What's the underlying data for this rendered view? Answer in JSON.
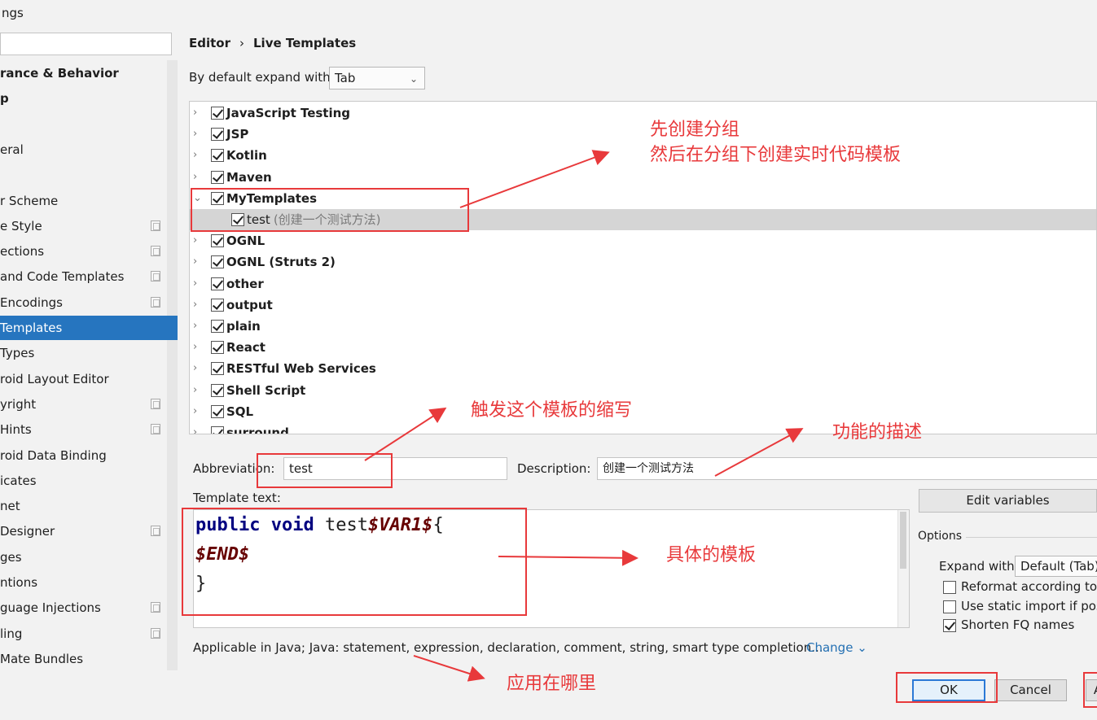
{
  "window": {
    "title": "ngs"
  },
  "sidebar": {
    "search_value": "",
    "items": [
      {
        "label": "rance & Behavior",
        "bold": true,
        "project": false
      },
      {
        "label": "p",
        "bold": true,
        "project": false
      },
      {
        "label": "",
        "bold": false,
        "project": false
      },
      {
        "label": "eral",
        "bold": false,
        "project": false
      },
      {
        "label": "",
        "bold": false,
        "project": false
      },
      {
        "label": "r Scheme",
        "bold": false,
        "project": false
      },
      {
        "label": "e Style",
        "bold": false,
        "project": true
      },
      {
        "label": "ections",
        "bold": false,
        "project": true
      },
      {
        "label": "and Code Templates",
        "bold": false,
        "project": true
      },
      {
        "label": "Encodings",
        "bold": false,
        "project": true
      },
      {
        "label": "Templates",
        "bold": false,
        "project": false
      },
      {
        "label": "Types",
        "bold": false,
        "project": false
      },
      {
        "label": "roid Layout Editor",
        "bold": false,
        "project": false
      },
      {
        "label": "yright",
        "bold": false,
        "project": true
      },
      {
        "label": "Hints",
        "bold": false,
        "project": true
      },
      {
        "label": "roid Data Binding",
        "bold": false,
        "project": false
      },
      {
        "label": "icates",
        "bold": false,
        "project": false
      },
      {
        "label": "net",
        "bold": false,
        "project": false
      },
      {
        "label": "Designer",
        "bold": false,
        "project": true
      },
      {
        "label": "ges",
        "bold": false,
        "project": false
      },
      {
        "label": "ntions",
        "bold": false,
        "project": false
      },
      {
        "label": "guage Injections",
        "bold": false,
        "project": true
      },
      {
        "label": "ling",
        "bold": false,
        "project": true
      },
      {
        "label": "Mate Bundles",
        "bold": false,
        "project": false
      }
    ],
    "selected_index": 10
  },
  "header": {
    "breadcrumb_editor": "Editor",
    "breadcrumb_sep": "›",
    "breadcrumb_page": "Live Templates",
    "expand_label": "By default expand with",
    "expand_value": "Tab"
  },
  "tree": {
    "groups": [
      {
        "label": "JavaScript Testing",
        "expanded": false
      },
      {
        "label": "JSP",
        "expanded": false
      },
      {
        "label": "Kotlin",
        "expanded": false
      },
      {
        "label": "Maven",
        "expanded": false
      },
      {
        "label": "MyTemplates",
        "expanded": true
      },
      {
        "label": "test",
        "child": true,
        "desc": "(创建一个测试方法)"
      },
      {
        "label": "OGNL",
        "expanded": false
      },
      {
        "label": "OGNL (Struts 2)",
        "expanded": false
      },
      {
        "label": "other",
        "expanded": false
      },
      {
        "label": "output",
        "expanded": false
      },
      {
        "label": "plain",
        "expanded": false
      },
      {
        "label": "React",
        "expanded": false
      },
      {
        "label": "RESTful Web Services",
        "expanded": false
      },
      {
        "label": "Shell Script",
        "expanded": false
      },
      {
        "label": "SQL",
        "expanded": false
      },
      {
        "label": "surround",
        "expanded": false
      }
    ]
  },
  "form": {
    "abbreviation_label": "Abbreviation:",
    "abbreviation_value": "test",
    "description_label": "Description:",
    "description_value": "创建一个测试方法",
    "template_text_label": "Template text:"
  },
  "code": {
    "kw_public": "public",
    "kw_void": "void",
    "method": " test",
    "var1": "$VAR1$",
    "brace_open": "{",
    "end_var": "$END$",
    "brace_close": "}"
  },
  "options": {
    "edit_variables": "Edit variables",
    "title": "Options",
    "expand_with_label": "Expand with",
    "expand_with_value": "Default (Tab)",
    "reformat": {
      "label": "Reformat according to",
      "checked": false
    },
    "static_import": {
      "label": "Use static import if pos",
      "checked": false
    },
    "shorten_fq": {
      "label": "Shorten FQ names",
      "checked": true
    }
  },
  "applicable": {
    "text": "Applicable in Java; Java: statement, expression, declaration, comment, string, smart type completion...",
    "change_label": "Change ⌄"
  },
  "buttons": {
    "ok": "OK",
    "cancel": "Cancel",
    "apply": "A"
  },
  "annotations": {
    "group_note_line1": "先创建分组",
    "group_note_line2": "然后在分组下创建实时代码模板",
    "abbr_note": "触发这个模板的缩写",
    "desc_note": "功能的描述",
    "template_note": "具体的模板",
    "applicable_note": "应用在哪里",
    "color": "#e8393b"
  }
}
